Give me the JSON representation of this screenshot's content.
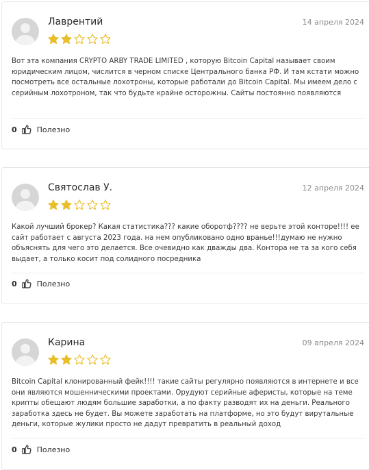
{
  "reviews": [
    {
      "name": "Лаврентий",
      "date": "14 апреля 2024",
      "rating": 2,
      "rating_max": 5,
      "text": "Вот эта компания CRYPTO ARBY TRADE LIMITED , которую Bitcoin Capital называет своим юридическим лицом, числится в черном списке Центрального банка РФ. И там кстати можно посмотреть все остальные лохотроны, которые работали до Bitcoin Capital. Мы имеем дело с серийным лохотроном, так что будьте крайне осторожны. Сайты постоянно появляются",
      "likes": "0",
      "useful_label": "Полезно"
    },
    {
      "name": "Святослав У.",
      "date": "12 апреля 2024",
      "rating": 2,
      "rating_max": 5,
      "text": "Какой лучший брокер? Какая статистика??? какие оборотф???? не верьте этой конторе!!!! ее сайт работает с августа 2023 года. на нем опубликовано одно вранье!!!думаю не нужно объяснять для чего это делается. Все очевидно как дважды два. Контора не та за кого себя выдает, а только косит под солидного посредника",
      "likes": "0",
      "useful_label": "Полезно"
    },
    {
      "name": "Карина",
      "date": "09 апреля 2024",
      "rating": 2,
      "rating_max": 5,
      "text": "Bitcoin Capital клонированный фейк!!!! такие сайты регулярно появляются в интернете и все они являются мошенническими проектами. Орудуют серийные аферисты, которые на теме крипты обещают людям большие заработки, а по факту разводят их на деньги. Реального заработка здесь не будет. Вы можете заработать на платформе, но это будут вирутальные деньги, которые жулики просто не дадут превратить в реальный доход",
      "likes": "0",
      "useful_label": "Полезно"
    }
  ],
  "colors": {
    "star_filled": "#e8be2a",
    "star_empty_stroke": "#e8be2a",
    "avatar_bg": "#d6d6d6"
  }
}
